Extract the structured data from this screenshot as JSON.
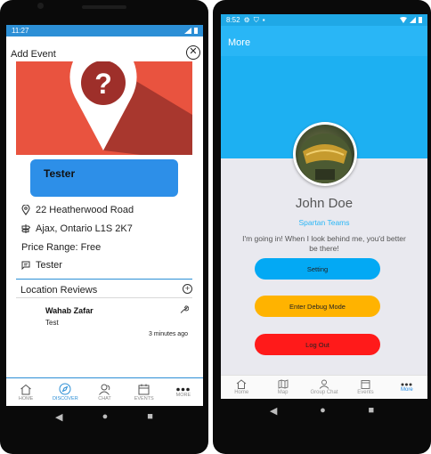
{
  "left_phone": {
    "status": {
      "time": "11:27"
    },
    "header": {
      "title": "Add Event",
      "close_icon": "close-icon"
    },
    "event": {
      "name": "Tester",
      "hero_icon": "question-map-pin-icon"
    },
    "details": {
      "street": "22 Heatherwood Road",
      "city": "Ajax, Ontario L1S 2K7",
      "price": "Price Range: Free",
      "host": "Tester"
    },
    "reviews": {
      "title": "Location Reviews",
      "items": [
        {
          "author": "Wahab Zafar",
          "text": "Test",
          "time": "3 minutes ago"
        }
      ]
    },
    "tabs": [
      {
        "label": "HOME",
        "icon": "home-icon"
      },
      {
        "label": "DISCOVER",
        "icon": "compass-icon",
        "active": true
      },
      {
        "label": "CHAT",
        "icon": "chat-users-icon"
      },
      {
        "label": "EVENTS",
        "icon": "calendar-icon"
      },
      {
        "label": "MORE",
        "icon": "more-dots-icon"
      }
    ],
    "accent": "#2c8fd6"
  },
  "right_phone": {
    "status": {
      "time": "8:52"
    },
    "appbar": {
      "title": "More"
    },
    "profile": {
      "name": "John Doe",
      "team": "Spartan Teams",
      "quote": "I'm going in! When I look behind me, you'd better be there!"
    },
    "buttons": [
      {
        "label": "Setting",
        "color": "#03a9f4"
      },
      {
        "label": "Enter Debug Mode",
        "color": "#ffb300"
      },
      {
        "label": "Log Out",
        "color": "#ff1a1a"
      }
    ],
    "tabs": [
      {
        "label": "Home",
        "icon": "home-icon"
      },
      {
        "label": "Map",
        "icon": "map-icon"
      },
      {
        "label": "Group Chat",
        "icon": "group-chat-icon"
      },
      {
        "label": "Events",
        "icon": "calendar-icon"
      },
      {
        "label": "More",
        "icon": "more-dots-icon",
        "active": true
      }
    ]
  }
}
